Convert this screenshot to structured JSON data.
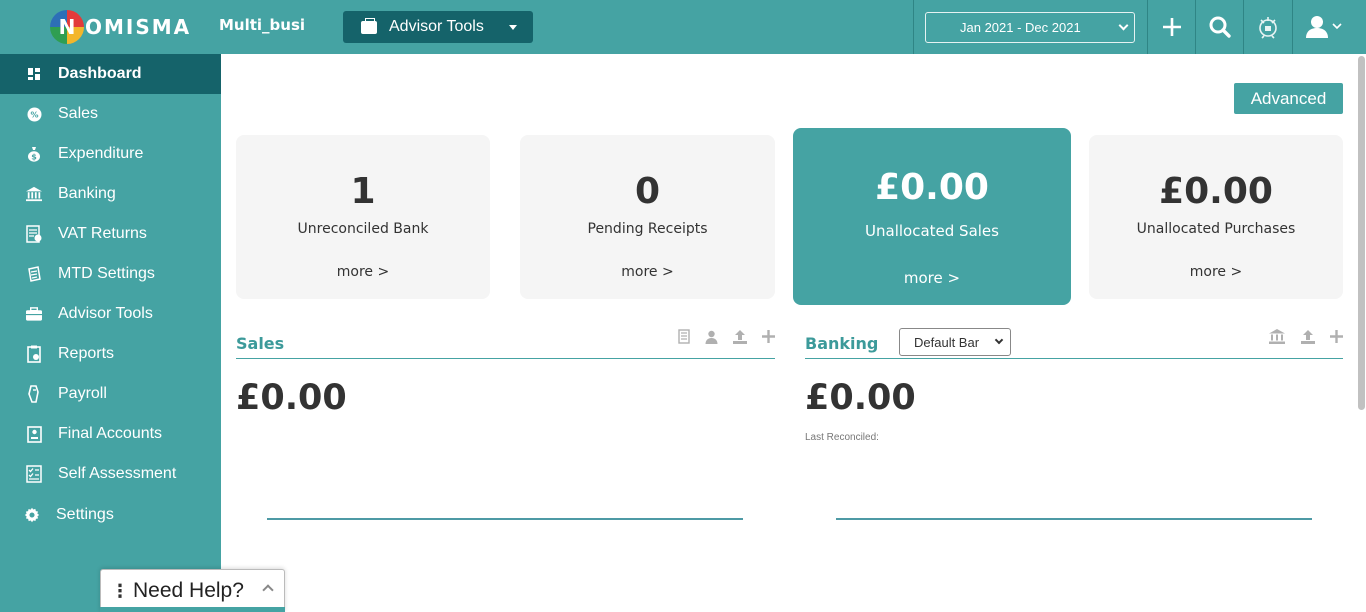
{
  "header": {
    "logo_text": "OMISMA",
    "logo_letter": "N",
    "company": "Multi_busi",
    "advisor_tools_label": "Advisor Tools",
    "date_range": "Jan 2021 - Dec 2021"
  },
  "sidebar": {
    "items": [
      {
        "label": "Dashboard",
        "icon": "dashboard-icon",
        "glyph": "▚"
      },
      {
        "label": "Sales",
        "icon": "sales-icon",
        "glyph": "%"
      },
      {
        "label": "Expenditure",
        "icon": "money-bag-icon",
        "glyph": "$"
      },
      {
        "label": "Banking",
        "icon": "bank-icon",
        "glyph": "⌂"
      },
      {
        "label": "VAT Returns",
        "icon": "vat-icon",
        "glyph": "▤"
      },
      {
        "label": "MTD Settings",
        "icon": "mtd-icon",
        "glyph": "✎"
      },
      {
        "label": "Advisor Tools",
        "icon": "briefcase-icon",
        "glyph": "▬"
      },
      {
        "label": "Reports",
        "icon": "reports-icon",
        "glyph": "▥"
      },
      {
        "label": "Payroll",
        "icon": "payroll-icon",
        "glyph": "✋"
      },
      {
        "label": "Final Accounts",
        "icon": "final-accounts-icon",
        "glyph": "▣"
      },
      {
        "label": "Self Assessment",
        "icon": "self-assessment-icon",
        "glyph": "☑"
      },
      {
        "label": "Settings",
        "icon": "gear-icon",
        "glyph": "⚙"
      }
    ]
  },
  "main": {
    "advanced_label": "Advanced",
    "cards": [
      {
        "value": "1",
        "label": "Unreconciled Bank",
        "more": "more >"
      },
      {
        "value": "0",
        "label": "Pending Receipts",
        "more": "more >"
      },
      {
        "value": "£0.00",
        "label": "Unallocated Sales",
        "more": "more >"
      },
      {
        "value": "£0.00",
        "label": "Unallocated Purchases",
        "more": "more >"
      }
    ],
    "sales": {
      "title": "Sales",
      "amount": "£0.00"
    },
    "banking": {
      "title": "Banking",
      "amount": "£0.00",
      "select_value": "Default Bar",
      "last_reconciled": "Last Reconciled:"
    }
  },
  "help": {
    "label": "Need Help?"
  },
  "colors": {
    "teal": "#45a3a3",
    "dark_teal": "#15636a"
  }
}
